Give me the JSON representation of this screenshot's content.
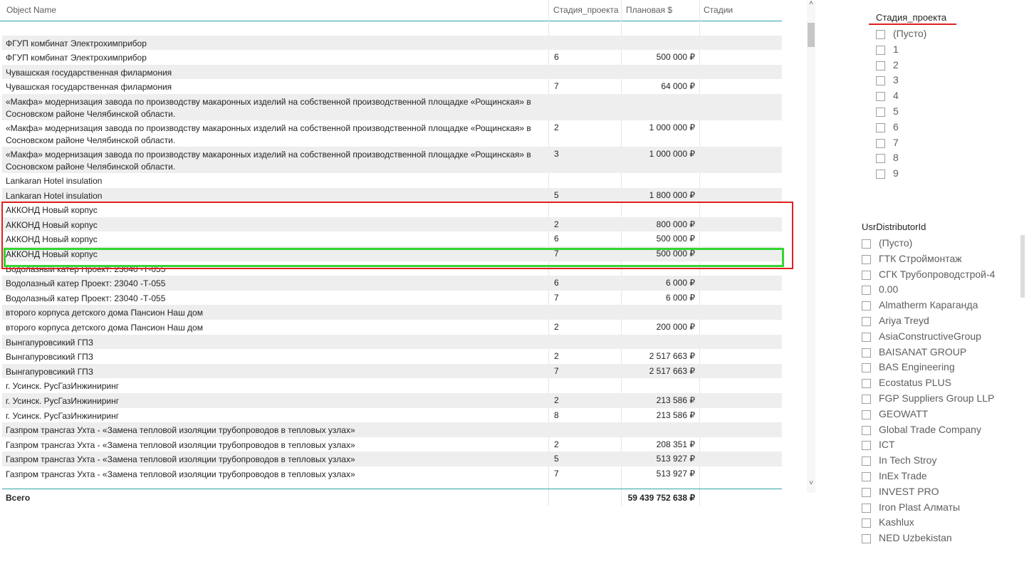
{
  "table": {
    "columns": [
      "Object Name",
      "Стадия_проекта",
      "Плановая $",
      "Стадии"
    ],
    "rows": [
      {
        "name": "",
        "stage": "",
        "plan": ""
      },
      {
        "name": "ФГУП комбинат Электрохимприбор",
        "stage": "",
        "plan": ""
      },
      {
        "name": "ФГУП комбинат Электрохимприбор",
        "stage": "6",
        "plan": "500 000 ₽"
      },
      {
        "name": "Чувашская государственная филармония",
        "stage": "",
        "plan": ""
      },
      {
        "name": "Чувашская государственная филармония",
        "stage": "7",
        "plan": "64 000 ₽"
      },
      {
        "name": "«Макфа» модернизация завода по производству макаронных изделий на собственной производственной площадке «Рощинская» в Сосновском районе Челябинской области.",
        "stage": "",
        "plan": ""
      },
      {
        "name": "«Макфа» модернизация завода по производству макаронных изделий на собственной производственной площадке «Рощинская» в Сосновском районе Челябинской области.",
        "stage": "2",
        "plan": "1 000 000 ₽"
      },
      {
        "name": "«Макфа» модернизация завода по производству макаронных изделий на собственной производственной площадке «Рощинская» в Сосновском районе Челябинской области.",
        "stage": "3",
        "plan": "1 000 000 ₽"
      },
      {
        "name": "Lankaran Hotel insulation",
        "stage": "",
        "plan": ""
      },
      {
        "name": "Lankaran Hotel insulation",
        "stage": "5",
        "plan": "1 800 000 ₽"
      },
      {
        "name": "АККОНД Новый корпус",
        "stage": "",
        "plan": ""
      },
      {
        "name": "АККОНД Новый корпус",
        "stage": "2",
        "plan": "800 000 ₽"
      },
      {
        "name": "АККОНД Новый корпус",
        "stage": "6",
        "plan": "500 000 ₽"
      },
      {
        "name": "АККОНД Новый корпус",
        "stage": "7",
        "plan": "500 000 ₽"
      },
      {
        "name": "Водолазный катер Проект: 23040 -Т-055",
        "stage": "",
        "plan": ""
      },
      {
        "name": "Водолазный катер Проект: 23040 -Т-055",
        "stage": "6",
        "plan": "6 000 ₽"
      },
      {
        "name": "Водолазный катер Проект: 23040 -Т-055",
        "stage": "7",
        "plan": "6 000 ₽"
      },
      {
        "name": "второго корпуса детского дома Пансион Наш дом",
        "stage": "",
        "plan": ""
      },
      {
        "name": "второго корпуса детского дома Пансион Наш дом",
        "stage": "2",
        "plan": "200 000 ₽"
      },
      {
        "name": "Вынгапуровсикий ГПЗ",
        "stage": "",
        "plan": ""
      },
      {
        "name": "Вынгапуровсикий ГПЗ",
        "stage": "2",
        "plan": "2 517 663 ₽"
      },
      {
        "name": "Вынгапуровсикий ГПЗ",
        "stage": "7",
        "plan": "2 517 663 ₽"
      },
      {
        "name": "г. Усинск. РусГазИнжиниринг",
        "stage": "",
        "plan": ""
      },
      {
        "name": "г. Усинск. РусГазИнжиниринг",
        "stage": "2",
        "plan": "213 586 ₽"
      },
      {
        "name": "г. Усинск. РусГазИнжиниринг",
        "stage": "8",
        "plan": "213 586 ₽"
      },
      {
        "name": "Газпром трансгаз Ухта - «Замена тепловой изоляции трубопроводов в тепловых узлах»",
        "stage": "",
        "plan": ""
      },
      {
        "name": "Газпром трансгаз Ухта - «Замена тепловой изоляции трубопроводов в тепловых узлах»",
        "stage": "2",
        "plan": "208 351 ₽"
      },
      {
        "name": "Газпром трансгаз Ухта - «Замена тепловой изоляции трубопроводов в тепловых узлах»",
        "stage": "5",
        "plan": "513 927 ₽"
      },
      {
        "name": "Газпром трансгаз Ухта - «Замена тепловой изоляции трубопроводов в тепловых узлах»",
        "stage": "7",
        "plan": "513 927 ₽"
      }
    ],
    "total": {
      "label": "Всего",
      "plan": "59 439 752 638 ₽"
    }
  },
  "scrollbar": {
    "up": "˄",
    "down": "˅"
  },
  "slicer_stage": {
    "title": "Стадия_проекта",
    "options": [
      "(Пусто)",
      "1",
      "2",
      "3",
      "4",
      "5",
      "6",
      "7",
      "8",
      "9"
    ]
  },
  "slicer_distributor": {
    "title": "UsrDistributorId",
    "options": [
      "(Пусто)",
      "ГТК Строймонтаж",
      "СГК Трубопроводстрой-4",
      "0.00",
      "Almatherm Караганда",
      "Ariya Treyd",
      "AsiaConstructiveGroup",
      "BAISANAT GROUP",
      "BAS Engineering",
      "Ecostatus PLUS",
      "FGP Suppliers Group LLP",
      "GEOWATT",
      "Global Trade Company",
      "ICT",
      "In Tech Stroy",
      "InEx Trade",
      "INVEST PRO",
      "Iron Plast Алматы",
      "Kashlux",
      "NED Uzbekistan"
    ]
  },
  "colors": {
    "highlight_red": "#e02020",
    "highlight_green": "#33d633",
    "accent_teal": "#2fa3a8",
    "band": "#eeeeee"
  }
}
